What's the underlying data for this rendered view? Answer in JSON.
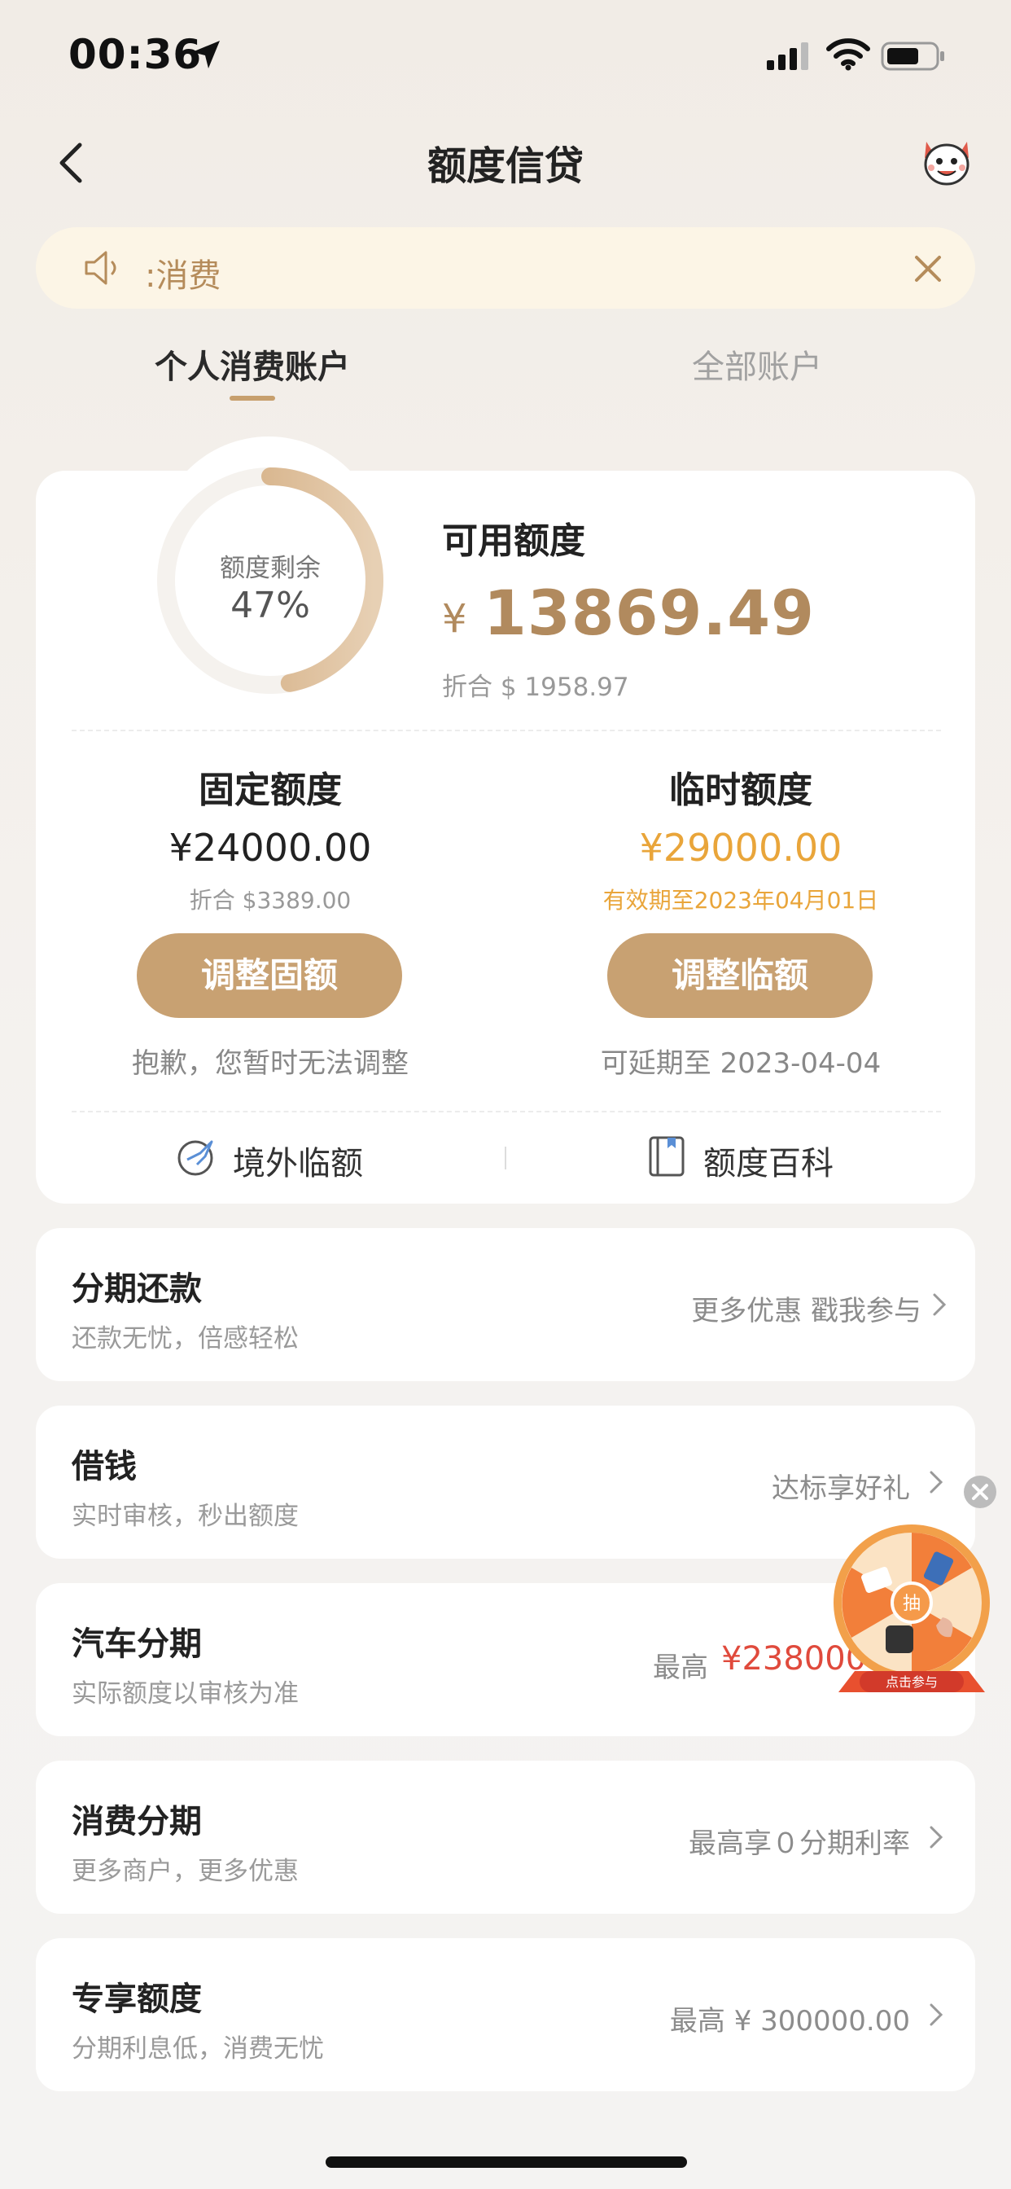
{
  "status_bar": {
    "time": "00:36"
  },
  "nav": {
    "title": "额度信贷"
  },
  "notice": {
    "text": ":消费"
  },
  "tabs": {
    "personal": "个人消费账户",
    "all": "全部账户"
  },
  "summary": {
    "ring_label": "额度剩余",
    "ring_percent": "47%",
    "ring_fraction": 0.47,
    "available_label": "可用额度",
    "available_currency": "¥",
    "available_amount": "13869.49",
    "available_approx": "折合 $ 1958.97"
  },
  "fixed": {
    "title": "固定额度",
    "amount": "¥24000.00",
    "approx": "折合 $3389.00",
    "button": "调整固额",
    "note": "抱歉，您暂时无法调整"
  },
  "temporary": {
    "title": "临时额度",
    "amount": "¥29000.00",
    "validity": "有效期至2023年04月01日",
    "button": "调整临额",
    "note": "可延期至 2023-04-04"
  },
  "links": {
    "overseas": "境外临额",
    "wiki": "额度百科"
  },
  "rows": [
    {
      "title": "分期还款",
      "subtitle": "还款无忧，倍感轻松",
      "right": "更多优惠 戳我参与"
    },
    {
      "title": "借钱",
      "subtitle": "实时审核，秒出额度",
      "right": "达标享好礼"
    },
    {
      "title": "汽车分期",
      "subtitle": "实际额度以审核为准",
      "right_prefix": "最高",
      "right_amount": "¥238000"
    },
    {
      "title": "消费分期",
      "subtitle": "更多商户，更多优惠",
      "right": "最高享０分期利率"
    },
    {
      "title": "专享额度",
      "subtitle": "分期利息低，消费无忧",
      "right": "最高 ¥ 300000.00"
    }
  ],
  "lottery": {
    "center": "抽",
    "banner": "点击参与"
  },
  "colors": {
    "accent": "#c8a172",
    "gold_text": "#b18a5e",
    "temp_orange": "#e9a53a",
    "red": "#e04a3c",
    "notice_bg": "#fcf5e6"
  }
}
